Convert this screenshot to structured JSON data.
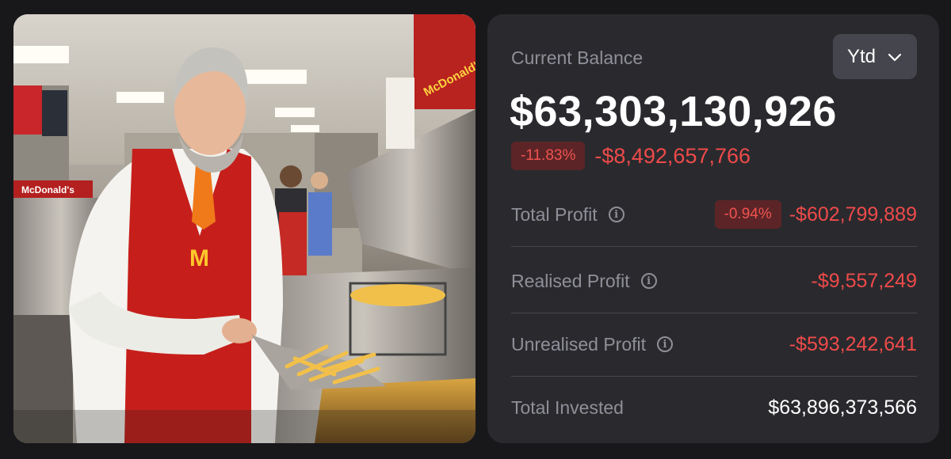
{
  "photo": {
    "signs": [
      "McDonald's",
      "McDonald's",
      "McDonald's"
    ]
  },
  "card": {
    "current_label": "Current Balance",
    "range_label": "Ytd",
    "balance": "$63,303,130,926",
    "change_pct": "-11.83%",
    "change_amount": "-$8,492,657,766",
    "rows": [
      {
        "label": "Total Profit",
        "pct": "-0.94%",
        "value": "-$602,799,889"
      },
      {
        "label": "Realised Profit",
        "value": "-$9,557,249"
      },
      {
        "label": "Unrealised Profit",
        "value": "-$593,242,641"
      },
      {
        "label": "Total Invested",
        "value": "$63,896,373,566"
      }
    ]
  },
  "colors": {
    "background": "#18181b",
    "card": "#2a2a2e",
    "negative": "#ef4a4a",
    "badge_bg": "#5c2426"
  },
  "icons": [
    "chevron-down-icon",
    "info-icon"
  ]
}
